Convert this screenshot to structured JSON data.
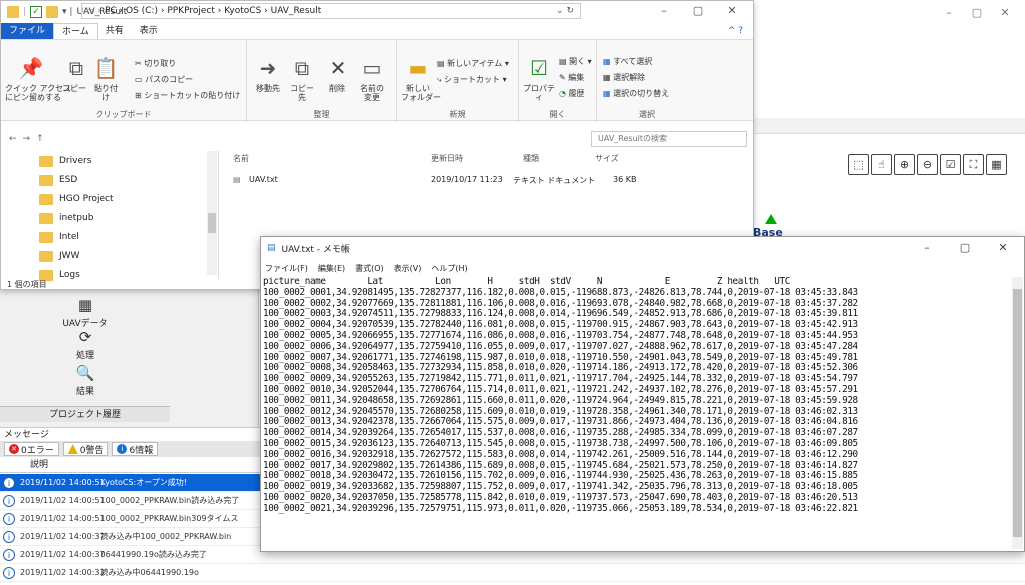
{
  "background": {
    "win_controls": [
      "–",
      "▢",
      "✕"
    ],
    "toolbar_icons": [
      "⬚",
      "☝",
      "⊕",
      "⊖",
      "☑",
      "⛶",
      "▦"
    ],
    "map_label": "Base",
    "left_items": [
      {
        "label": "UAVデータ",
        "icon": "uav-data-icon"
      },
      {
        "label": "処理",
        "icon": "process-icon"
      },
      {
        "label": "結果",
        "icon": "result-icon"
      }
    ],
    "history_label": "プロジェクト履歴",
    "messages_header": "メッセージ",
    "tabs": {
      "errors": "0エラー",
      "warnings": "0警告",
      "info": "6情報"
    },
    "column_label": "説明",
    "messages": [
      {
        "time": "2019/11/02 14:00:51",
        "text": "KyotoCS:オープン成功!",
        "selected": true
      },
      {
        "time": "2019/11/02 14:00:51",
        "text": "100_0002_PPKRAW.bin読み込み完了",
        "selected": false
      },
      {
        "time": "2019/11/02 14:00:51",
        "text": "100_0002_PPKRAW.bin309タイムス",
        "selected": false
      },
      {
        "time": "2019/11/02 14:00:37",
        "text": "読み込み中100_0002_PPKRAW.bin",
        "selected": false
      },
      {
        "time": "2019/11/02 14:00:37",
        "text": "06441990.19o読み込み完了",
        "selected": false
      },
      {
        "time": "2019/11/02 14:00:33",
        "text": "読み込み中06441990.19o",
        "selected": false
      }
    ]
  },
  "explorer": {
    "title": "UAV_Result",
    "controls": [
      "–",
      "▢",
      "✕"
    ],
    "tabs": [
      "ファイル",
      "ホーム",
      "共有",
      "表示"
    ],
    "ribbon": {
      "pin": "クイック アクセス\nにピン留めする",
      "copy": "コピー",
      "paste": "貼り付け",
      "cut": "切り取り",
      "copy_path": "パスのコピー",
      "paste_shortcut": "ショートカットの貼り付け",
      "clipboard": "クリップボード",
      "move_to": "移動先",
      "copy_to": "コピー先",
      "delete": "削除",
      "rename": "名前の\n変更",
      "organize": "整理",
      "new_folder": "新しい\nフォルダー",
      "new_item": "新しいアイテム ▾",
      "shortcut": "ショートカット ▾",
      "new_group": "新規",
      "properties": "プロパティ",
      "open": "開く ▾",
      "edit": "編集",
      "history": "履歴",
      "open_group": "開く",
      "select_all": "すべて選択",
      "select_none": "選択解除",
      "invert": "選択の切り替え",
      "select_group": "選択"
    },
    "address": "PC › OS (C:) › PPKProject › KyotoCS › UAV_Result",
    "search_placeholder": "UAV_Resultの検索",
    "folders": [
      "Drivers",
      "ESD",
      "HGO Project",
      "inetpub",
      "Intel",
      "JWW",
      "Logs"
    ],
    "status": "1 個の項目",
    "columns": {
      "name": "名前",
      "date": "更新日時",
      "type": "種類",
      "size": "サイズ"
    },
    "file": {
      "name": "UAV.txt",
      "date": "2019/10/17 11:23",
      "type": "テキスト ドキュメント",
      "size": "36 KB"
    }
  },
  "notepad": {
    "title": "UAV.txt - メモ帳",
    "controls": [
      "–",
      "▢",
      "✕"
    ],
    "menu": [
      "ファイル(F)",
      "編集(E)",
      "書式(O)",
      "表示(V)",
      "ヘルプ(H)"
    ],
    "header": "picture_name        Lat          Lon       H     stdH  stdV     N            E         Z health   UTC",
    "lines": [
      "100_0002_0001,34.92081495,135.72827377,116.182,0.008,0.015,-119688.873,-24826.813,78.744,0,2019-07-18 03:45:33.843",
      "100_0002_0002,34.92077669,135.72811881,116.106,0.008,0.016,-119693.078,-24840.982,78.668,0,2019-07-18 03:45:37.282",
      "100_0002_0003,34.92074511,135.72798833,116.124,0.008,0.014,-119696.549,-24852.913,78.686,0,2019-07-18 03:45:39.811",
      "100_0002_0004,34.92070539,135.72782440,116.081,0.008,0.015,-119700.915,-24867.903,78.643,0,2019-07-18 03:45:42.913",
      "100_0002_0005,34.92066955,135.72771674,116.086,0.008,0.016,-119703.754,-24877.748,78.648,0,2019-07-18 03:45:44.953",
      "100_0002_0006,34.92064977,135.72759410,116.055,0.009,0.017,-119707.027,-24888.962,78.617,0,2019-07-18 03:45:47.284",
      "100_0002_0007,34.92061771,135.72746198,115.987,0.010,0.018,-119710.550,-24901.043,78.549,0,2019-07-18 03:45:49.781",
      "100_0002_0008,34.92058463,135.72732934,115.858,0.010,0.020,-119714.186,-24913.172,78.420,0,2019-07-18 03:45:52.306",
      "100_0002_0009,34.92055263,135.72719842,115.771,0.011,0.021,-119717.704,-24925.144,78.332,0,2019-07-18 03:45:54.797",
      "100_0002_0010,34.92052044,135.72706764,115.714,0.011,0.021,-119721.242,-24937.102,78.276,0,2019-07-18 03:45:57.291",
      "100_0002_0011,34.92048658,135.72692861,115.660,0.011,0.020,-119724.964,-24949.815,78.221,0,2019-07-18 03:45:59.928",
      "100_0002_0012,34.92045570,135.72680258,115.609,0.010,0.019,-119728.358,-24961.340,78.171,0,2019-07-18 03:46:02.313",
      "100_0002_0013,34.92042378,135.72667064,115.575,0.009,0.017,-119731.866,-24973.404,78.136,0,2019-07-18 03:46:04.816",
      "100_0002_0014,34.92039264,135.72654017,115.537,0.008,0.016,-119735.288,-24985.334,78.099,0,2019-07-18 03:46:07.287",
      "100_0002_0015,34.92036123,135.72640713,115.545,0.008,0.015,-119738.738,-24997.500,78.106,0,2019-07-18 03:46:09.805",
      "100_0002_0016,34.92032918,135.72627572,115.583,0.008,0.014,-119742.261,-25009.516,78.144,0,2019-07-18 03:46:12.290",
      "100_0002_0017,34.92029802,135.72614386,115.689,0.008,0.015,-119745.684,-25021.573,78.250,0,2019-07-18 03:46:14.827",
      "100_0002_0018,34.92030472,135.72610156,115.702,0.009,0.016,-119744.930,-25025.436,78.263,0,2019-07-18 03:46:15.885",
      "100_0002_0019,34.92033682,135.72598807,115.752,0.009,0.017,-119741.342,-25035.796,78.313,0,2019-07-18 03:46:18.005",
      "100_0002_0020,34.92037050,135.72585778,115.842,0.010,0.019,-119737.573,-25047.690,78.403,0,2019-07-18 03:46:20.513",
      "100_0002_0021,34.92039296,135.72579751,115.973,0.011,0.020,-119735.066,-25053.189,78.534,0,2019-07-18 03:46:22.821"
    ]
  }
}
